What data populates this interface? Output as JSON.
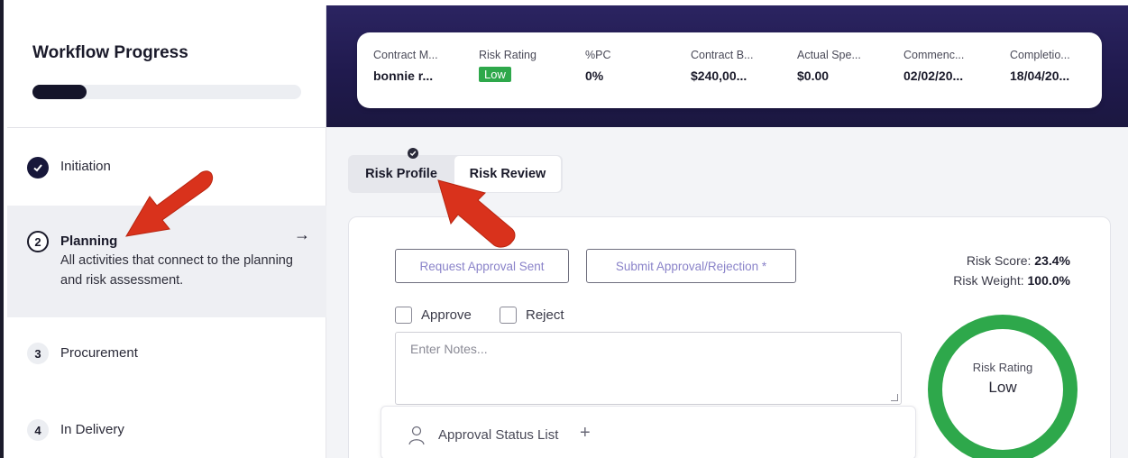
{
  "sidebar": {
    "title": "Workflow Progress",
    "progress_fraction": 0.2,
    "steps": [
      {
        "number": "",
        "label": "Initiation",
        "state": "done"
      },
      {
        "number": "2",
        "label": "Planning",
        "state": "current",
        "description": "All activities that connect to the planning and risk assessment."
      },
      {
        "number": "3",
        "label": "Procurement",
        "state": "upcoming"
      },
      {
        "number": "4",
        "label": "In Delivery",
        "state": "upcoming"
      }
    ]
  },
  "summary": {
    "items": [
      {
        "label": "Contract M...",
        "value": "bonnie r..."
      },
      {
        "label": "Risk Rating",
        "value": "Low"
      },
      {
        "label": "%PC",
        "value": "0%"
      },
      {
        "label": "Contract B...",
        "value": "$240,00..."
      },
      {
        "label": "Actual Spe...",
        "value": "$0.00"
      },
      {
        "label": "Commenc...",
        "value": "02/02/20..."
      },
      {
        "label": "Completio...",
        "value": "18/04/20..."
      }
    ]
  },
  "tabs": {
    "profile": "Risk Profile",
    "review": "Risk Review"
  },
  "actions": {
    "request_label": "Request Approval Sent",
    "submit_label": "Submit Approval/Rejection *",
    "approve_label": "Approve",
    "reject_label": "Reject",
    "notes_placeholder": "Enter Notes...",
    "approval_status_label": "Approval Status List",
    "approval_plus": "+"
  },
  "risk": {
    "score_label": "Risk Score:",
    "score_value": "23.4%",
    "weight_label": "Risk Weight:",
    "weight_value": "100.0%",
    "rating_label": "Risk Rating",
    "rating_value": "Low",
    "ring_color": "#2ea84b"
  },
  "colors": {
    "accent_dark": "#15152a",
    "header_band": "#221c50",
    "low_badge": "#2ea84b",
    "annotation_arrow": "#d9321c"
  }
}
